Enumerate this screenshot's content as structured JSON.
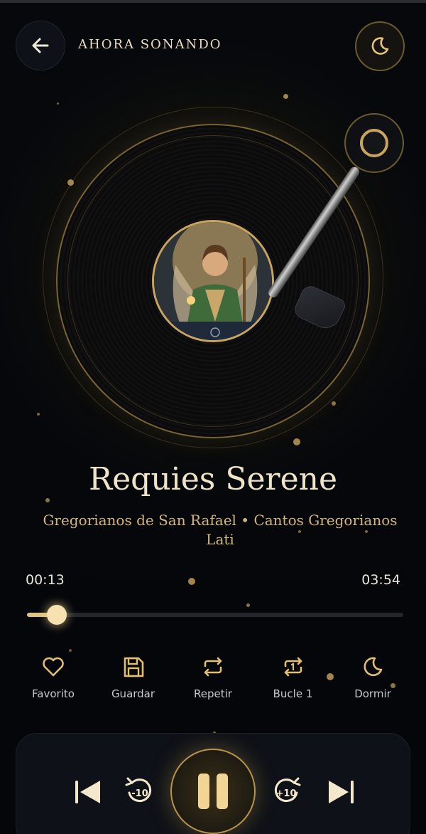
{
  "header": {
    "title": "AHORA SONANDO"
  },
  "track": {
    "title": "Requies Serene",
    "artist_line": "Gregorianos de San Rafael  •  Cantos Gregorianos Lati"
  },
  "progress": {
    "current": "00:13",
    "total": "03:54",
    "fraction": 0.08
  },
  "actions": [
    {
      "label": "Favorito",
      "icon": "heart-icon"
    },
    {
      "label": "Guardar",
      "icon": "save-icon"
    },
    {
      "label": "Repetir",
      "icon": "repeat-icon"
    },
    {
      "label": "Bucle 1",
      "icon": "repeat-one-icon"
    },
    {
      "label": "Dormir",
      "icon": "moon-icon"
    }
  ],
  "controls": {
    "back_seconds": "10",
    "forward_seconds": "10",
    "state": "playing"
  },
  "colors": {
    "accent": "#d9b46a",
    "background": "#05070b",
    "text_muted": "#c8c9cc"
  }
}
